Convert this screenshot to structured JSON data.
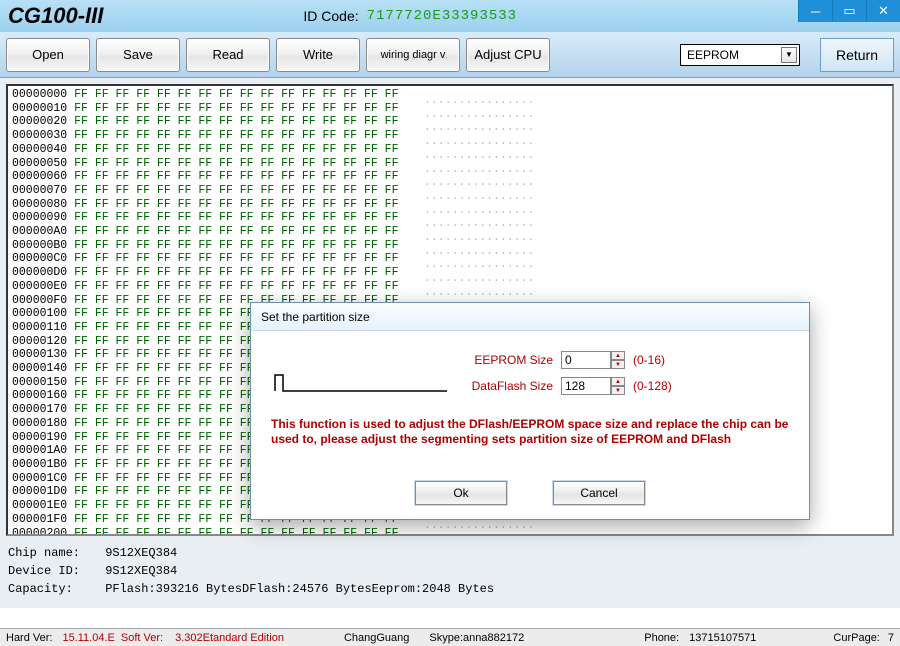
{
  "titlebar": {
    "app_name": "CG100-III",
    "id_label": "ID Code:",
    "id_code": "7177720E33393533"
  },
  "toolbar": {
    "open": "Open",
    "save": "Save",
    "read": "Read",
    "write": "Write",
    "wiring": "wiring diagr v",
    "adjust": "Adjust CPU",
    "combo_value": "EEPROM",
    "return": "Return"
  },
  "hex": {
    "row_count": 39,
    "start_addr_hex": "00000000",
    "bytes_per_row": 16,
    "byte_value": "FF",
    "ascii_fill": "................"
  },
  "info": {
    "chip_name_label": "Chip name:",
    "chip_name": "9S12XEQ384",
    "device_id_label": "Device ID:",
    "device_id": "9S12XEQ384",
    "capacity_label": "Capacity:",
    "capacity": "PFlash:393216 BytesDFlash:24576 BytesEeprom:2048 Bytes"
  },
  "status": {
    "hard_label": "Hard Ver:",
    "hard_value": "15.11.04.E",
    "soft_label": "Soft Ver:",
    "soft_value": "3.302",
    "edition": "Etandard Edition",
    "author": "ChangGuang",
    "skype_label": "Skype:",
    "skype": "anna882172",
    "phone_label": "Phone:",
    "phone": "13715107571",
    "curpage_label": "CurPage:",
    "curpage": "7"
  },
  "dialog": {
    "title": "Set the partition size",
    "eeprom_label": "EEPROM Size",
    "eeprom_value": "0",
    "eeprom_range": "(0-16)",
    "dflash_label": "DataFlash Size",
    "dflash_value": "128",
    "dflash_range": "(0-128)",
    "message": "This function is used to adjust the DFlash/EEPROM space size and replace the chip can be used to, please adjust the segmenting sets partition size of EEPROM and DFlash",
    "ok": "Ok",
    "cancel": "Cancel"
  }
}
